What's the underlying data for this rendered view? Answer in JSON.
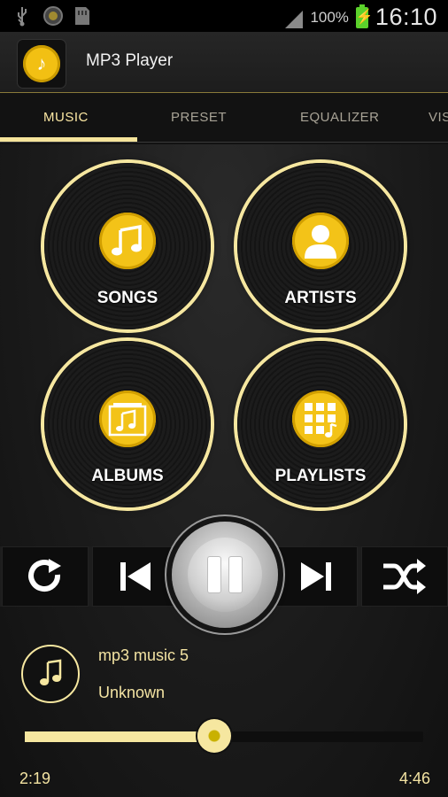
{
  "status_bar": {
    "battery_text": "100%",
    "time": "16:10",
    "icons": [
      "usb-icon",
      "app-notification-icon",
      "sd-card-icon",
      "signal-icon",
      "battery-charging-icon"
    ]
  },
  "app": {
    "title": "MP3 Player"
  },
  "tabs": [
    {
      "label": "MUSIC",
      "active": true
    },
    {
      "label": "PRESET",
      "active": false
    },
    {
      "label": "EQUALIZER",
      "active": false
    },
    {
      "label": "VIS",
      "active": false
    }
  ],
  "categories": [
    {
      "label": "SONGS",
      "icon": "music-notes-icon"
    },
    {
      "label": "ARTISTS",
      "icon": "person-icon"
    },
    {
      "label": "ALBUMS",
      "icon": "album-icon"
    },
    {
      "label": "PLAYLISTS",
      "icon": "playlist-grid-icon"
    }
  ],
  "controls": [
    "repeat-icon",
    "previous-icon",
    "pause-icon",
    "next-icon",
    "shuffle-icon"
  ],
  "now_playing": {
    "title": "mp3 music 5",
    "artist": "Unknown",
    "elapsed": "2:19",
    "total": "4:46",
    "progress": 0.475
  },
  "colors": {
    "accent": "#f6e7a0",
    "badge": "#f3c318"
  }
}
